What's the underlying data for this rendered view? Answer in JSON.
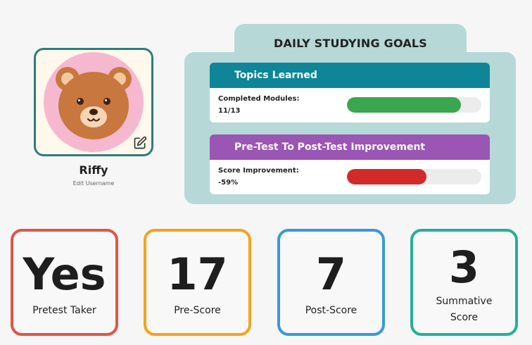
{
  "profile": {
    "username": "Riffy",
    "edit_username_label": "Edit Username",
    "avatar_icon": "teddy-bear-icon",
    "edit_icon": "pencil-square-icon"
  },
  "goals": {
    "title": "DAILY STUDYING GOALS",
    "topics": {
      "header": "Topics Learned",
      "label": "Completed Modules:",
      "value": "11/13",
      "progress": 0.846,
      "color": "#3ba650"
    },
    "improvement": {
      "header": "Pre-Test To Post-Test Improvement",
      "label": "Score Improvement:",
      "value": "-59%",
      "progress": 0.59,
      "color": "#d22a2a"
    }
  },
  "stats": [
    {
      "value": "Yes",
      "label": "Pretest Taker",
      "color": "#e05548"
    },
    {
      "value": "17",
      "label": "Pre-Score",
      "color": "#f5a21d"
    },
    {
      "value": "7",
      "label": "Post-Score",
      "color": "#3a98d8"
    },
    {
      "value": "3",
      "label": "Summative Score",
      "color": "#26b094"
    }
  ],
  "colors": {
    "topics_header": "#0f8598",
    "improvement_header": "#9a55b5",
    "panel": "#b6d8d6",
    "avatar_border": "#2e7d78"
  }
}
